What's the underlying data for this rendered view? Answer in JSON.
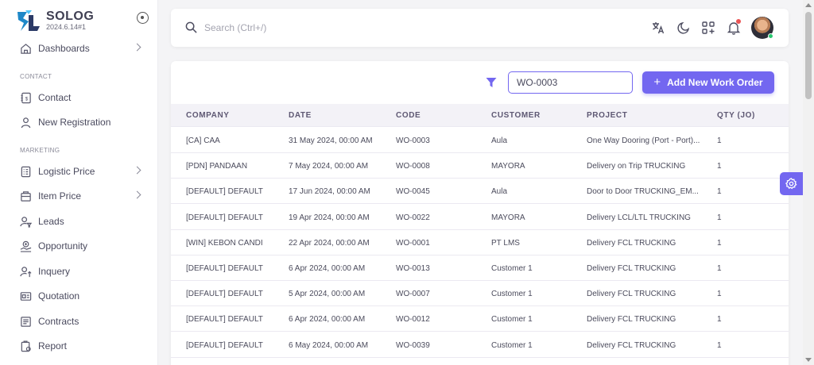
{
  "brand": {
    "name": "SOLOG",
    "version": "2024.6.14#1"
  },
  "sidebar": {
    "dashboards": "Dashboards",
    "section_contact": "CONTACT",
    "contact": "Contact",
    "new_registration": "New Registration",
    "section_marketing": "MARKETING",
    "logistic_price": "Logistic Price",
    "item_price": "Item Price",
    "leads": "Leads",
    "opportunity": "Opportunity",
    "inquery": "Inquery",
    "quotation": "Quotation",
    "contracts": "Contracts",
    "report": "Report"
  },
  "header": {
    "search_placeholder": "Search (Ctrl+/)"
  },
  "toolbar": {
    "filter_value": "WO-0003",
    "add_label": "Add New Work Order"
  },
  "table": {
    "columns": [
      "COMPANY",
      "DATE",
      "CODE",
      "CUSTOMER",
      "PROJECT",
      "QTY (JO)"
    ],
    "rows": [
      [
        "[CA] CAA",
        "31 May 2024, 00:00 AM",
        "WO-0003",
        "Aula",
        "One Way Dooring (Port - Port)...",
        "1"
      ],
      [
        "[PDN] PANDAAN",
        "7 May 2024, 00:00 AM",
        "WO-0008",
        "MAYORA",
        "Delivery on Trip TRUCKING",
        "1"
      ],
      [
        "[DEFAULT] DEFAULT",
        "17 Jun 2024, 00:00 AM",
        "WO-0045",
        "Aula",
        "Door to Door TRUCKING_EM...",
        "1"
      ],
      [
        "[DEFAULT] DEFAULT",
        "19 Apr 2024, 00:00 AM",
        "WO-0022",
        "MAYORA",
        "Delivery LCL/LTL TRUCKING",
        "1"
      ],
      [
        "[WIN] KEBON CANDI",
        "22 Apr 2024, 00:00 AM",
        "WO-0001",
        "PT LMS",
        "Delivery FCL TRUCKING",
        "1"
      ],
      [
        "[DEFAULT] DEFAULT",
        "6 Apr 2024, 00:00 AM",
        "WO-0013",
        "Customer 1",
        "Delivery FCL TRUCKING",
        "1"
      ],
      [
        "[DEFAULT] DEFAULT",
        "5 Apr 2024, 00:00 AM",
        "WO-0007",
        "Customer 1",
        "Delivery FCL TRUCKING",
        "1"
      ],
      [
        "[DEFAULT] DEFAULT",
        "6 Apr 2024, 00:00 AM",
        "WO-0012",
        "Customer 1",
        "Delivery FCL TRUCKING",
        "1"
      ],
      [
        "[DEFAULT] DEFAULT",
        "6 May 2024, 00:00 AM",
        "WO-0039",
        "Customer 1",
        "Delivery FCL TRUCKING",
        "1"
      ]
    ]
  },
  "colors": {
    "accent": "#7367f0",
    "status_online": "#28c76f",
    "notification": "#ea5455"
  }
}
